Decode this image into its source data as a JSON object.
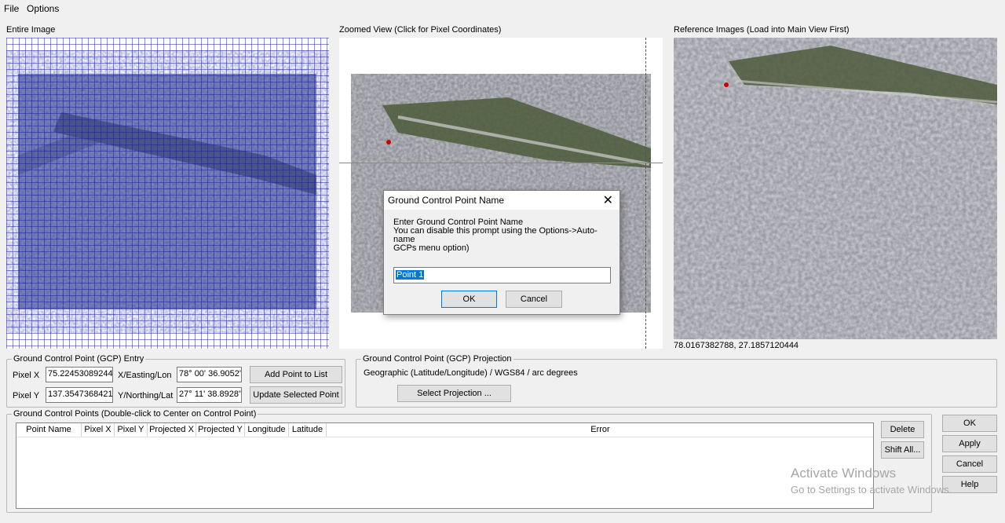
{
  "menu": {
    "file": "File",
    "options": "Options"
  },
  "panels": {
    "entire": "Entire Image",
    "zoomed": "Zoomed View (Click for Pixel Coordinates)",
    "reference": "Reference Images (Load into Main View First)",
    "reference_coords": "78.0167382788, 27.1857120444"
  },
  "gcp_entry": {
    "legend": "Ground Control Point (GCP) Entry",
    "pixel_x_label": "Pixel X",
    "pixel_x_value": "75.22453089244",
    "pixel_y_label": "Pixel Y",
    "pixel_y_value": "137.35473684210",
    "easting_label": "X/Easting/Lon",
    "easting_value": "78° 00' 36.9052''",
    "northing_label": "Y/Northing/Lat",
    "northing_value": "27° 11' 38.8928''",
    "add_button": "Add Point to List",
    "update_button": "Update Selected Point"
  },
  "projection": {
    "legend": "Ground Control Point (GCP) Projection",
    "text": "Geographic (Latitude/Longitude) / WGS84 / arc degrees",
    "select_button": "Select Projection ..."
  },
  "points": {
    "legend": "Ground Control Points (Double-click to Center on Control Point)",
    "columns": [
      "Point Name",
      "Pixel X",
      "Pixel Y",
      "Projected X",
      "Projected Y",
      "Longitude",
      "Latitude",
      "Error"
    ],
    "delete_button": "Delete",
    "shift_button": "Shift All..."
  },
  "buttons": {
    "ok": "OK",
    "apply": "Apply",
    "cancel": "Cancel",
    "help": "Help"
  },
  "dialog": {
    "title": "Ground Control Point Name",
    "close": "✕",
    "line1": "Enter Ground Control Point Name",
    "line2": "You can disable this prompt using the Options->Auto-name",
    "line3": "GCPs menu option)",
    "input_value": "Point 1",
    "ok": "OK",
    "cancel": "Cancel"
  },
  "watermark": {
    "line1": "Activate Windows",
    "line2": "Go to Settings to activate Windows."
  }
}
